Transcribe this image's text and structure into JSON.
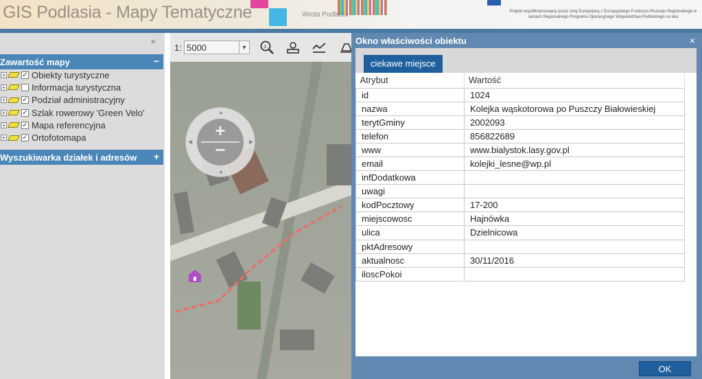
{
  "header": {
    "title": "GIS Podlasia - Mapy Tematyczne",
    "logo_text": "Wrota Podlasia",
    "eu_text": "Projekt współfinansowany przez Unię Europejską z Europejskiego Funduszu Rozwoju Regionalnego w ramach Regionalnego Programu Operacyjnego Województwa Podlaskiego na lata"
  },
  "sidebar": {
    "collapse_glyph": "«",
    "map_contents": {
      "title": "Zawartość mapy",
      "sign": "−",
      "layers": [
        {
          "label": "Obiekty turystyczne",
          "checked": true
        },
        {
          "label": "Informacja turystyczna",
          "checked": false
        },
        {
          "label": "Podział administracyjny",
          "checked": true
        },
        {
          "label": "Szlak rowerowy 'Green Velo'",
          "checked": true
        },
        {
          "label": "Mapa referencyjna",
          "checked": true
        },
        {
          "label": "Ortofotomapa",
          "checked": true
        }
      ]
    },
    "search": {
      "title": "Wyszukiwarka działek i adresów",
      "sign": "+"
    }
  },
  "map": {
    "scale_prefix": "1:",
    "scale_value": "5000",
    "tools": [
      "zoom-to-scale-icon",
      "layer-icon",
      "profile-icon",
      "print-icon"
    ]
  },
  "dialog": {
    "title": "Okno właściwości obiektu",
    "close": "×",
    "tab": "ciekawe miejsce",
    "columns": [
      "Atrybut",
      "Wartość"
    ],
    "rows": [
      {
        "attr": "id",
        "value": "1024"
      },
      {
        "attr": "nazwa",
        "value": "Kolejka wąskotorowa po Puszczy Białowieskiej"
      },
      {
        "attr": "terytGminy",
        "value": "2002093"
      },
      {
        "attr": "telefon",
        "value": "856822689"
      },
      {
        "attr": "www",
        "value": "www.bialystok.lasy.gov.pl"
      },
      {
        "attr": "email",
        "value": "kolejki_lesne@wp.pl"
      },
      {
        "attr": "infDodatkowa",
        "value": ""
      },
      {
        "attr": "uwagi",
        "value": ""
      },
      {
        "attr": "kodPocztowy",
        "value": "17-200"
      },
      {
        "attr": "miejscowosc",
        "value": "Hajnówka"
      },
      {
        "attr": "ulica",
        "value": "Dzielnicowa"
      },
      {
        "attr": "pktAdresowy",
        "value": ""
      },
      {
        "attr": "aktualnosc",
        "value": "30/11/2016"
      },
      {
        "attr": "iloscPokoi",
        "value": ""
      }
    ],
    "ok_label": "OK"
  },
  "colors": {
    "accent": "#4a86b8",
    "dialog_bg": "#6088b0",
    "button": "#1f5f9e"
  }
}
